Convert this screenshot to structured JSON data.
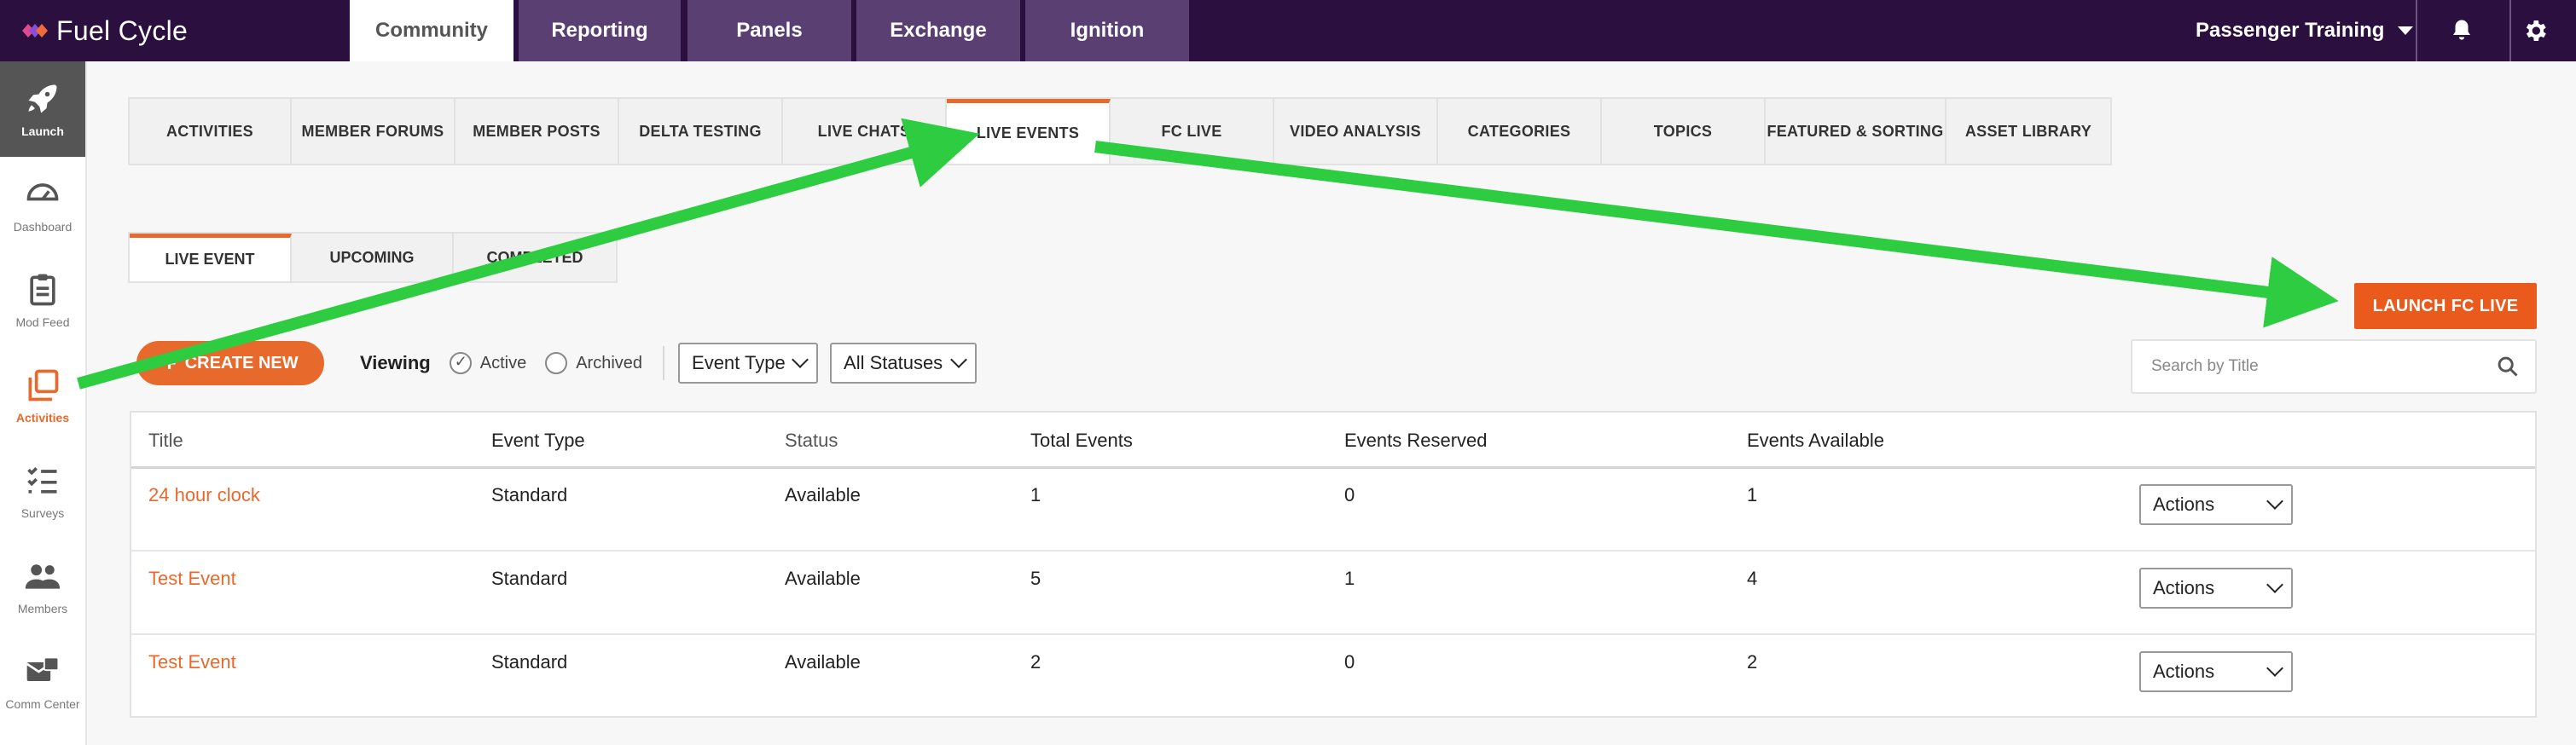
{
  "brand": {
    "name": "Fuel Cycle",
    "colors": {
      "primary": "#2a0f3f",
      "accent": "#e8692c",
      "annotation": "#2ecc40"
    }
  },
  "top_nav": {
    "tabs": [
      {
        "label": "Community",
        "active": true
      },
      {
        "label": "Reporting",
        "active": false
      },
      {
        "label": "Panels",
        "active": false
      },
      {
        "label": "Exchange",
        "active": false
      },
      {
        "label": "Ignition",
        "active": false
      }
    ],
    "account": "Passenger Training",
    "icons": [
      "bell-icon",
      "gear-icon"
    ]
  },
  "sidebar": {
    "items": [
      {
        "label": "Launch",
        "icon": "rocket-icon",
        "active": true
      },
      {
        "label": "Dashboard",
        "icon": "gauge-icon"
      },
      {
        "label": "Mod Feed",
        "icon": "clipboard-icon"
      },
      {
        "label": "Activities",
        "icon": "copy-icon",
        "highlight": true
      },
      {
        "label": "Surveys",
        "icon": "checklist-icon"
      },
      {
        "label": "Members",
        "icon": "users-icon"
      },
      {
        "label": "Comm Center",
        "icon": "mail-icon"
      }
    ]
  },
  "subnav": {
    "tabs": [
      {
        "label": "ACTIVITIES"
      },
      {
        "label": "MEMBER FORUMS"
      },
      {
        "label": "MEMBER POSTS"
      },
      {
        "label": "DELTA TESTING"
      },
      {
        "label": "LIVE CHATS"
      },
      {
        "label": "LIVE EVENTS",
        "active": true
      },
      {
        "label": "FC LIVE"
      },
      {
        "label": "VIDEO ANALYSIS"
      },
      {
        "label": "CATEGORIES"
      },
      {
        "label": "TOPICS"
      },
      {
        "label": "FEATURED & SORTING"
      },
      {
        "label": "ASSET LIBRARY"
      }
    ]
  },
  "status_tabs": [
    {
      "label": "LIVE EVENT",
      "active": true
    },
    {
      "label": "UPCOMING"
    },
    {
      "label": "COMPLETED"
    }
  ],
  "launch_button": "LAUNCH FC LIVE",
  "toolbar": {
    "create_label": "CREATE NEW",
    "viewing_label": "Viewing",
    "radio_active": "Active",
    "radio_archived": "Archived",
    "event_type": "Event Type",
    "statuses": "All Statuses"
  },
  "search": {
    "placeholder": "Search by Title"
  },
  "table": {
    "headers": [
      "Title",
      "Event Type",
      "Status",
      "Total Events",
      "Events Reserved",
      "Events Available"
    ],
    "rows": [
      {
        "title": "24 hour clock",
        "type": "Standard",
        "status": "Available",
        "total": "1",
        "reserved": "0",
        "available": "1",
        "action": "Actions"
      },
      {
        "title": "Test Event",
        "type": "Standard",
        "status": "Available",
        "total": "5",
        "reserved": "1",
        "available": "4",
        "action": "Actions"
      },
      {
        "title": "Test Event",
        "type": "Standard",
        "status": "Available",
        "total": "2",
        "reserved": "0",
        "available": "2",
        "action": "Actions"
      }
    ]
  }
}
